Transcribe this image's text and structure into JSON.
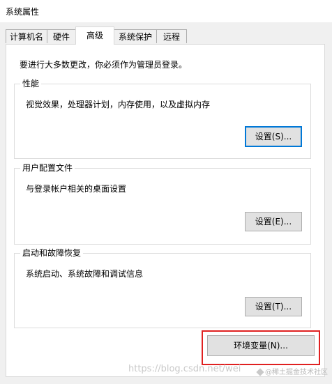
{
  "window": {
    "title": "系统属性"
  },
  "tabs": [
    {
      "label": "计算机名"
    },
    {
      "label": "硬件"
    },
    {
      "label": "高级",
      "active": true
    },
    {
      "label": "系统保护"
    },
    {
      "label": "远程"
    }
  ],
  "admin_note": "要进行大多数更改，你必须作为管理员登录。",
  "performance": {
    "legend": "性能",
    "description": "视觉效果，处理器计划，内存使用，以及虚拟内存",
    "button": "设置(S)..."
  },
  "user_profiles": {
    "legend": "用户配置文件",
    "description": "与登录帐户相关的桌面设置",
    "button": "设置(E)..."
  },
  "startup_recovery": {
    "legend": "启动和故障恢复",
    "description": "系统启动、系统故障和调试信息",
    "button": "设置(T)..."
  },
  "env_button": "环境变量(N)...",
  "watermark": {
    "url": "https://blog.csdn.net/wei",
    "site": "@稀土掘金技术社区"
  },
  "colors": {
    "focus_border": "#0078d7",
    "highlight_box": "#e02020"
  }
}
